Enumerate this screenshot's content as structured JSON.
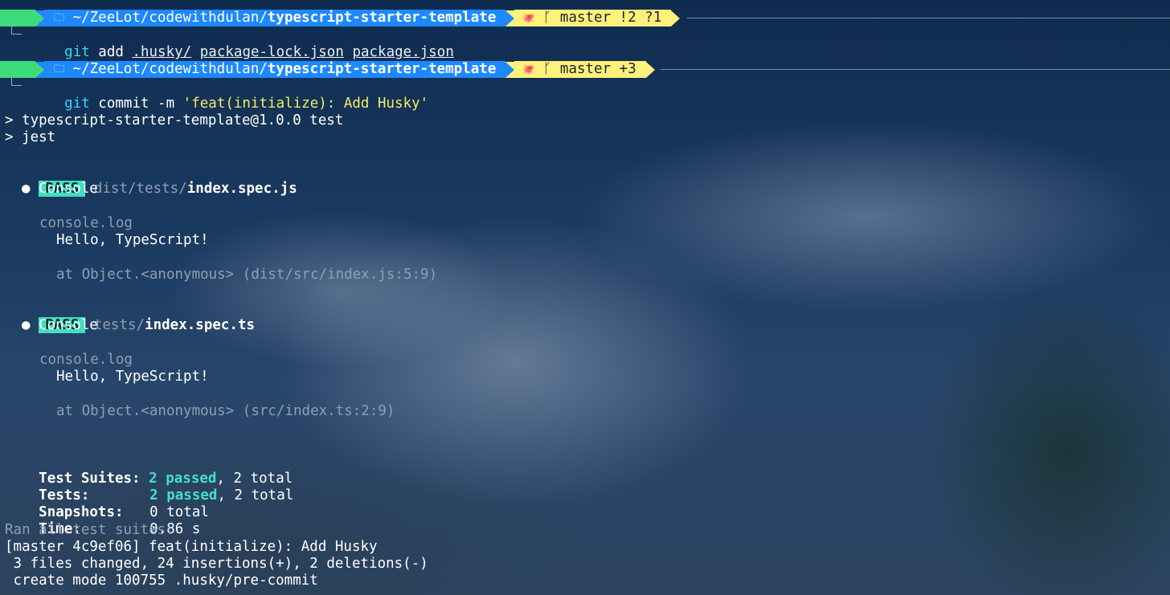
{
  "prompt1": {
    "apple": "",
    "folder_icon": "🗀",
    "path_prefix": "~/ZeeLot/codewithdulan/",
    "path_repo": "typescript-starter-template",
    "git_icon": "🐙",
    "branch_icon": "ᚴ",
    "branch": "master !2 ?1"
  },
  "cmd1": {
    "cmd": "git",
    "word": " add ",
    "a1": ".husky/",
    "a2": "package-lock.json",
    "a3": "package.json"
  },
  "prompt2": {
    "apple": "",
    "folder_icon": "🗀",
    "path_prefix": "~/ZeeLot/codewithdulan/",
    "path_repo": "typescript-starter-template",
    "git_icon": "🐙",
    "branch_icon": "ᚴ",
    "branch": "master +3"
  },
  "cmd2": {
    "cmd": "git",
    "word": " commit -m ",
    "msg": "'feat(initialize): Add Husky'"
  },
  "output": {
    "npm1": "> typescript-starter-template@1.0.0 test",
    "npm2": "> jest",
    "test1": {
      "badge": "PASS",
      "dir": "dist/tests/",
      "file": "index.spec.js",
      "console": "● Console",
      "log_label": "console.log",
      "log_msg": "Hello, TypeScript!",
      "at": "at Object.<anonymous> (dist/src/index.js:5:9)"
    },
    "test2": {
      "badge": "PASS",
      "dir": "tests/",
      "file": "index.spec.ts",
      "console": "● Console",
      "log_label": "console.log",
      "log_msg": "Hello, TypeScript!",
      "at": "at Object.<anonymous> (src/index.ts:2:9)"
    },
    "summary": {
      "suites_label": "Test Suites:",
      "suites_passed": "2 passed",
      "suites_total": ", 2 total",
      "tests_label": "Tests:",
      "tests_passed": "2 passed",
      "tests_total": ", 2 total",
      "snap_label": "Snapshots:",
      "snap_val": "0 total",
      "time_label": "Time:",
      "time_val": "0.86 s",
      "ran": "Ran all test suites."
    },
    "commit1": "[master 4c9ef06] feat(initialize): Add Husky",
    "commit2": " 3 files changed, 24 insertions(+), 2 deletions(-)",
    "commit3": " create mode 100755 .husky/pre-commit"
  },
  "colors": {
    "apple_segment": "#3ddc7a",
    "path_segment": "#1e88ff",
    "git_segment": "#fff27a",
    "pass_badge": "#40e0c0"
  }
}
